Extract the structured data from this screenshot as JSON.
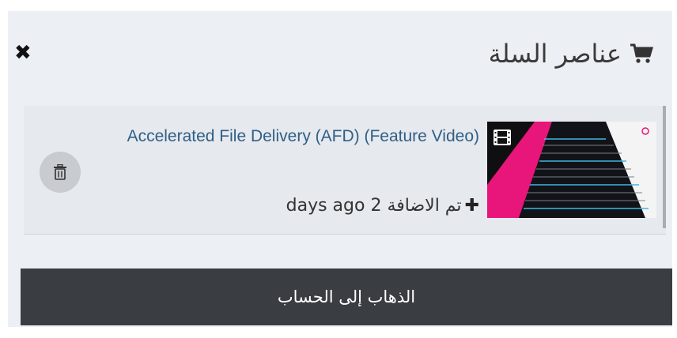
{
  "header": {
    "title": "عناصر السلة",
    "cart_icon": "shopping-cart-icon",
    "close_icon": "close-icon",
    "close_symbol": "✖"
  },
  "cart_items": [
    {
      "title": "Accelerated File Delivery (AFD) (Feature Video)",
      "added_label": "تم الاضافة 2 days ago",
      "plus_icon": "plus-icon",
      "thumbnail_icon": "film-icon",
      "delete_icon": "trash-icon"
    }
  ],
  "checkout": {
    "label": "الذهاب إلى الحساب"
  },
  "colors": {
    "panel_bg": "#eceff3",
    "link": "#2f5f86",
    "button_bg": "#3a3d42",
    "thumb_accent": "#e8157a"
  }
}
